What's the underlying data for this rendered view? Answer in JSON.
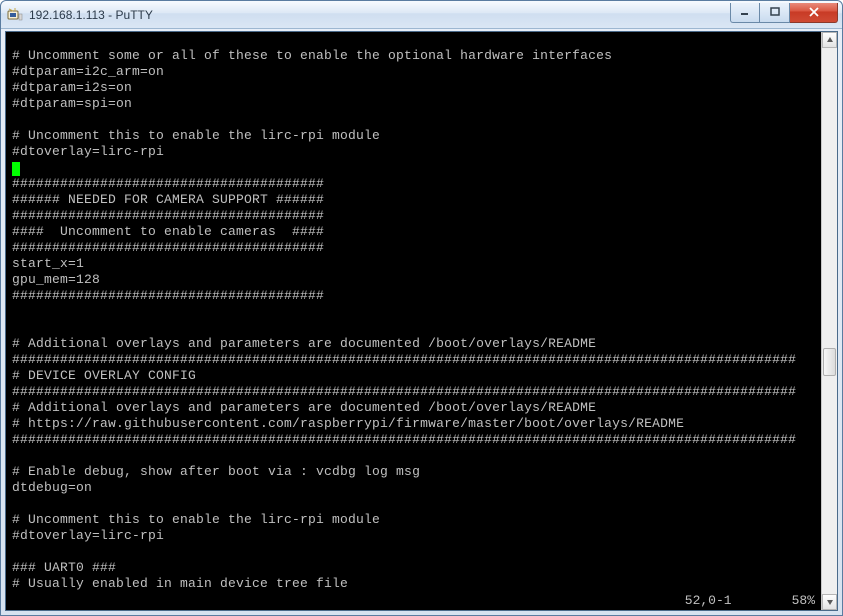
{
  "window": {
    "title": "192.168.1.113 - PuTTY"
  },
  "scrollbar": {
    "thumb_top_pct": 55,
    "thumb_height_pct": 5
  },
  "status": {
    "position": "52,0-1",
    "percent": "58%"
  },
  "terminal": {
    "lines": [
      "",
      "# Uncomment some or all of these to enable the optional hardware interfaces",
      "#dtparam=i2c_arm=on",
      "#dtparam=i2s=on",
      "#dtparam=spi=on",
      "",
      "# Uncomment this to enable the lirc-rpi module",
      "#dtoverlay=lirc-rpi",
      "<<CURSOR>>",
      "#######################################",
      "###### NEEDED FOR CAMERA SUPPORT ######",
      "#######################################",
      "####  Uncomment to enable cameras  ####",
      "#######################################",
      "start_x=1",
      "gpu_mem=128",
      "#######################################",
      "",
      "",
      "# Additional overlays and parameters are documented /boot/overlays/README",
      "##################################################################################################",
      "# DEVICE OVERLAY CONFIG",
      "##################################################################################################",
      "# Additional overlays and parameters are documented /boot/overlays/README",
      "# https://raw.githubusercontent.com/raspberrypi/firmware/master/boot/overlays/README",
      "##################################################################################################",
      "",
      "# Enable debug, show after boot via : vcdbg log msg",
      "dtdebug=on",
      "",
      "# Uncomment this to enable the lirc-rpi module",
      "#dtoverlay=lirc-rpi",
      "",
      "### UART0 ###",
      "# Usually enabled in main device tree file"
    ]
  }
}
